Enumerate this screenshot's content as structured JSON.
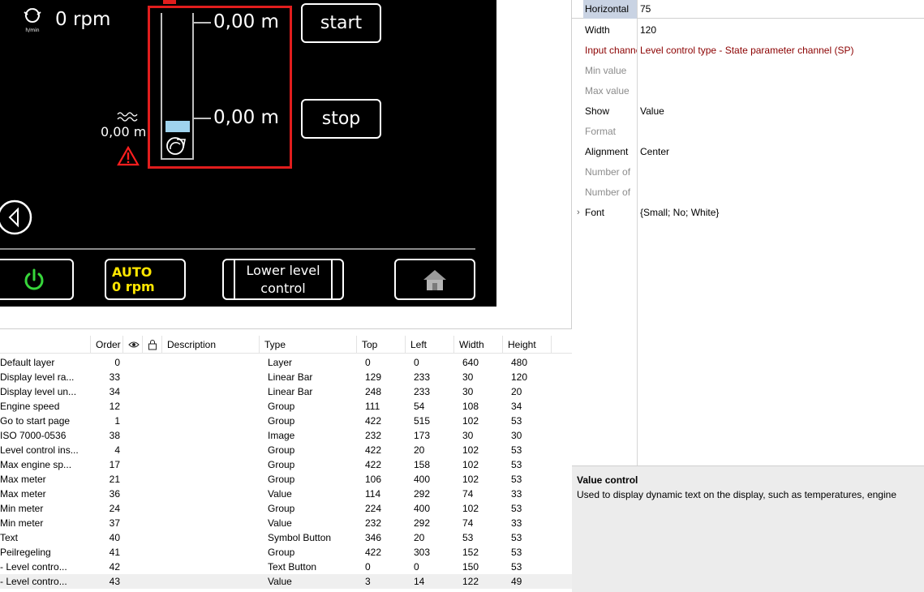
{
  "display": {
    "rpm": "0 rpm",
    "engine_icon_label": "h/min",
    "level_value": "0,00 m",
    "max_value": "0,00 m",
    "min_value": "0,00 m",
    "start_label": "start",
    "stop_label": "stop",
    "auto_line1": "AUTO",
    "auto_line2": "0 rpm",
    "lower_line1": "Lower level",
    "lower_line2": "control",
    "tank_fill_fraction": 0.08
  },
  "properties": {
    "rows": [
      {
        "label": "Horizontal",
        "value": "75",
        "style": "selected"
      },
      {
        "label": "Width",
        "value": "120",
        "style": "normal"
      },
      {
        "label": "Input channel",
        "value": "Level control type - State parameter channel (SP)",
        "style": "red"
      },
      {
        "label": "Min value",
        "value": "",
        "style": "dim"
      },
      {
        "label": "Max value",
        "value": "",
        "style": "dim"
      },
      {
        "label": "Show",
        "value": "Value",
        "style": "normal"
      },
      {
        "label": "Format",
        "value": "",
        "style": "dim"
      },
      {
        "label": "Alignment",
        "value": "Center",
        "style": "normal"
      },
      {
        "label": "Number of",
        "value": "",
        "style": "dim"
      },
      {
        "label": "Number of",
        "value": "",
        "style": "dim"
      },
      {
        "label": "Font",
        "value": "{Small; No; White}",
        "style": "normal"
      }
    ]
  },
  "description": {
    "title": "Value control",
    "text": "Used to display dynamic text on the display, such as temperatures, engine"
  },
  "table": {
    "headers": {
      "order": "Order",
      "description": "Description",
      "type": "Type",
      "top": "Top",
      "left": "Left",
      "width": "Width",
      "height": "Height"
    },
    "rows": [
      {
        "name": "Default layer",
        "order": "0",
        "type": "Layer",
        "top": "0",
        "left": "0",
        "width": "640",
        "height": "480"
      },
      {
        "name": "Display level ra...",
        "order": "33",
        "type": "Linear Bar",
        "top": "129",
        "left": "233",
        "width": "30",
        "height": "120"
      },
      {
        "name": "Display level un...",
        "order": "34",
        "type": "Linear Bar",
        "top": "248",
        "left": "233",
        "width": "30",
        "height": "20"
      },
      {
        "name": "Engine speed",
        "order": "12",
        "type": "Group",
        "top": "111",
        "left": "54",
        "width": "108",
        "height": "34"
      },
      {
        "name": "Go to start page",
        "order": "1",
        "type": "Group",
        "top": "422",
        "left": "515",
        "width": "102",
        "height": "53"
      },
      {
        "name": "ISO 7000-0536",
        "order": "38",
        "type": "Image",
        "top": "232",
        "left": "173",
        "width": "30",
        "height": "30"
      },
      {
        "name": "Level control ins...",
        "order": "4",
        "type": "Group",
        "top": "422",
        "left": "20",
        "width": "102",
        "height": "53"
      },
      {
        "name": "Max engine sp...",
        "order": "17",
        "type": "Group",
        "top": "422",
        "left": "158",
        "width": "102",
        "height": "53"
      },
      {
        "name": "Max meter",
        "order": "21",
        "type": "Group",
        "top": "106",
        "left": "400",
        "width": "102",
        "height": "53"
      },
      {
        "name": "Max meter",
        "order": "36",
        "type": "Value",
        "top": "114",
        "left": "292",
        "width": "74",
        "height": "33"
      },
      {
        "name": "Min meter",
        "order": "24",
        "type": "Group",
        "top": "224",
        "left": "400",
        "width": "102",
        "height": "53"
      },
      {
        "name": "Min meter",
        "order": "37",
        "type": "Value",
        "top": "232",
        "left": "292",
        "width": "74",
        "height": "33"
      },
      {
        "name": "Text",
        "order": "40",
        "type": "Symbol Button",
        "top": "346",
        "left": "20",
        "width": "53",
        "height": "53"
      },
      {
        "name": "Peilregeling",
        "order": "41",
        "type": "Group",
        "top": "422",
        "left": "303",
        "width": "152",
        "height": "53"
      },
      {
        "name": "- Level contro...",
        "order": "42",
        "type": "Text Button",
        "top": "0",
        "left": "0",
        "width": "150",
        "height": "53"
      },
      {
        "name": "- Level contro...",
        "order": "43",
        "type": "Value",
        "top": "3",
        "left": "14",
        "width": "122",
        "height": "49"
      }
    ]
  }
}
